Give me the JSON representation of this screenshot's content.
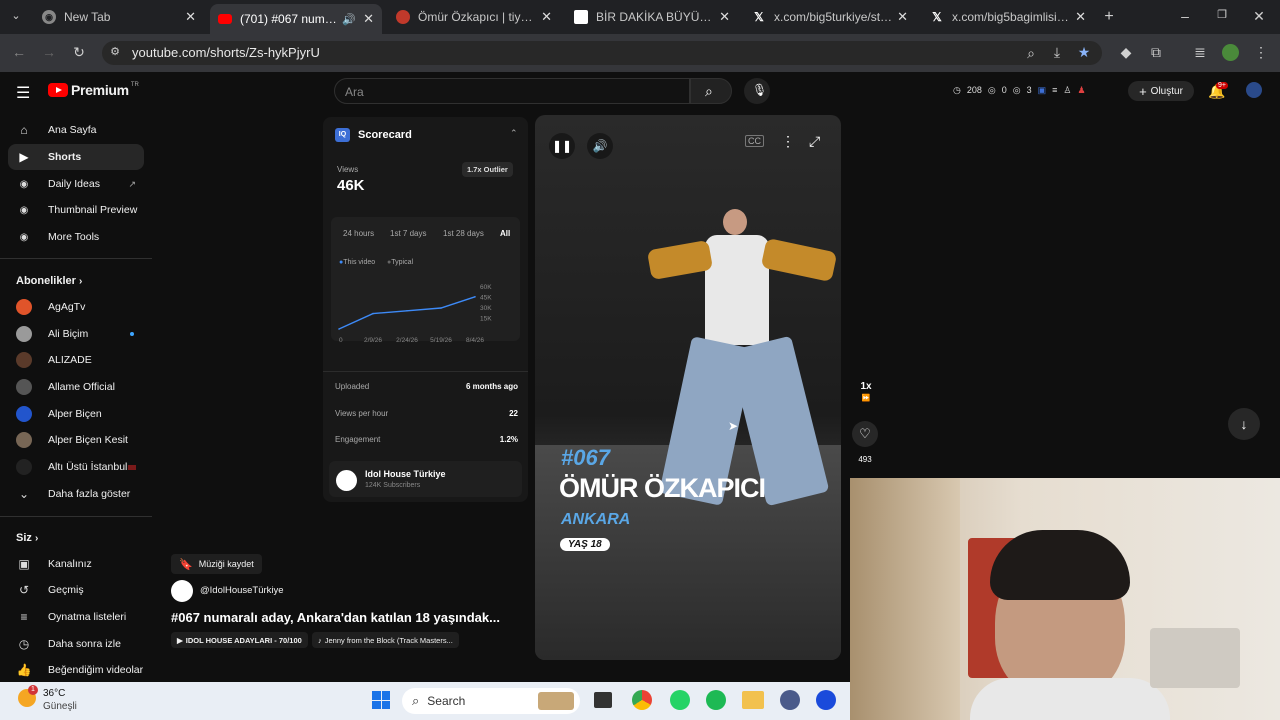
{
  "browser": {
    "tabs": [
      {
        "title": "New Tab",
        "active": false
      },
      {
        "title": "(701) #067 numaralı aday",
        "active": true
      },
      {
        "title": "Ömür Özkapıcı | tiyatrolar...",
        "active": false
      },
      {
        "title": "BİR DAKİKA BÜYÜKLER – K",
        "active": false
      },
      {
        "title": "x.com/big5turkiye/status/2",
        "active": false
      },
      {
        "title": "x.com/big5bagimlisi/status",
        "active": false
      }
    ],
    "url": "youtube.com/shorts/Zs-hykPjyrU"
  },
  "youtube": {
    "logo_text": "Premium",
    "logo_region": "TR",
    "search_placeholder": "Ara",
    "stats": {
      "a": "208",
      "b": "0",
      "c": "3"
    },
    "create_label": "Oluştur",
    "notif_badge": "9+"
  },
  "sidebar": {
    "items": [
      {
        "label": "Ana Sayfa"
      },
      {
        "label": "Shorts"
      },
      {
        "label": "Daily Ideas"
      },
      {
        "label": "Thumbnail Preview"
      },
      {
        "label": "More Tools"
      }
    ],
    "subs_heading": "Abonelikler",
    "subs": [
      {
        "label": "AgAgTv",
        "color": "#e0542a"
      },
      {
        "label": "Ali Biçim",
        "color": "#9a9a9a"
      },
      {
        "label": "ALIZADE",
        "color": "#5a3a2a"
      },
      {
        "label": "Allame Official",
        "color": "#555555"
      },
      {
        "label": "Alper Biçen",
        "color": "#2255cc"
      },
      {
        "label": "Alper Biçen Kesit",
        "color": "#776655"
      },
      {
        "label": "Altı Üstü İstanbul",
        "color": "#222222"
      }
    ],
    "show_more": "Daha fazla göster",
    "you_heading": "Siz",
    "you": [
      {
        "label": "Kanalınız"
      },
      {
        "label": "Geçmiş"
      },
      {
        "label": "Oynatma listeleri"
      },
      {
        "label": "Daha sonra izle"
      },
      {
        "label": "Beğendiğim videolar"
      }
    ]
  },
  "scorecard": {
    "title": "Scorecard",
    "views_label": "Views",
    "views": "46K",
    "outlier": "1.7x Outlier",
    "ranges": [
      "24 hours",
      "1st 7 days",
      "1st 28 days",
      "All"
    ],
    "legend": [
      "This video",
      "Typical"
    ],
    "uploaded_label": "Uploaded",
    "uploaded": "6 months ago",
    "vph_label": "Views per hour",
    "vph": "22",
    "engagement_label": "Engagement",
    "engagement": "1.2%",
    "channel": "Idol House Türkiye",
    "subscribers": "124K Subscribers"
  },
  "chart_data": {
    "type": "line",
    "x": [
      "0",
      "2/9/26",
      "2/24/26",
      "5/19/26",
      "8/4/26"
    ],
    "y_ticks": [
      "60K",
      "45K",
      "30K",
      "15K"
    ],
    "ylim": [
      0,
      60000
    ],
    "series": [
      {
        "values": [
          0,
          22000,
          26000,
          30000,
          46000
        ]
      }
    ]
  },
  "video": {
    "number": "#067",
    "name": "ÖMÜR ÖZKAPICI",
    "city": "ANKARA",
    "age": "YAŞ 18",
    "speed": "1x",
    "likes": "493"
  },
  "below_video": {
    "save_music": "Müziği kaydet",
    "channel": "@IdolHouseTürkiye",
    "title": "#067 numaralı aday, Ankara'dan katılan 18 yaşındak...",
    "chip1": "IDOL HOUSE ADAYLARI - 70/100",
    "chip2": "Jenny from the Block (Track Masters..."
  },
  "taskbar": {
    "temp": "36°C",
    "weather": "Güneşli",
    "weather_badge": "1",
    "search": "Search"
  }
}
